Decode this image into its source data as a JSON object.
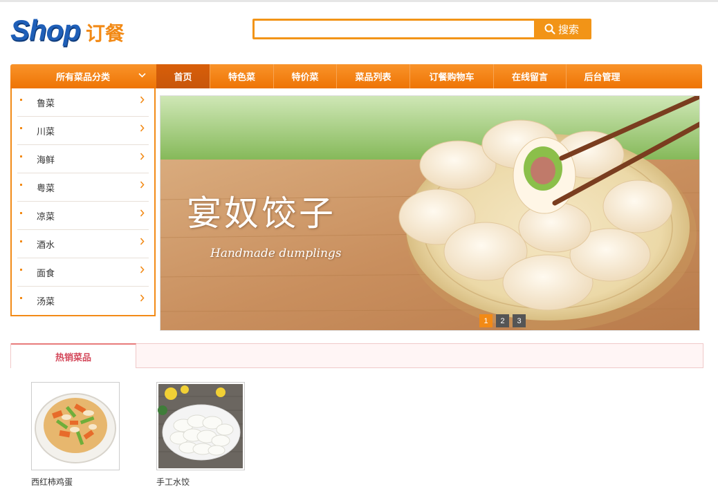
{
  "header": {
    "logo_text": "Shop",
    "logo_cn": "订餐",
    "search": {
      "value": "",
      "placeholder": "",
      "button_label": "搜索"
    }
  },
  "nav": {
    "category_header": "所有菜品分类",
    "items": [
      {
        "label": "首页",
        "active": true
      },
      {
        "label": "特色菜",
        "active": false
      },
      {
        "label": "特价菜",
        "active": false
      },
      {
        "label": "菜品列表",
        "active": false
      },
      {
        "label": "订餐购物车",
        "active": false
      },
      {
        "label": "在线留言",
        "active": false
      },
      {
        "label": "后台管理",
        "active": false
      }
    ]
  },
  "categories": [
    "鲁菜",
    "川菜",
    "海鲜",
    "粤菜",
    "凉菜",
    "酒水",
    "面食",
    "汤菜"
  ],
  "banner": {
    "title": "宴奴饺子",
    "subtitle": "Handmade dumplings",
    "pages": [
      "1",
      "2",
      "3"
    ],
    "active_page": 1
  },
  "hot": {
    "tab_label": "热销菜品",
    "products": [
      {
        "name": "西红柿鸡蛋",
        "image": "stir-fried-dish"
      },
      {
        "name": "手工水饺",
        "image": "dumplings-plate"
      }
    ]
  },
  "colors": {
    "accent": "#f28a16",
    "nav_active": "#c8560a",
    "logo_blue": "#1f5fb8",
    "hot_tab": "#d4495b"
  }
}
